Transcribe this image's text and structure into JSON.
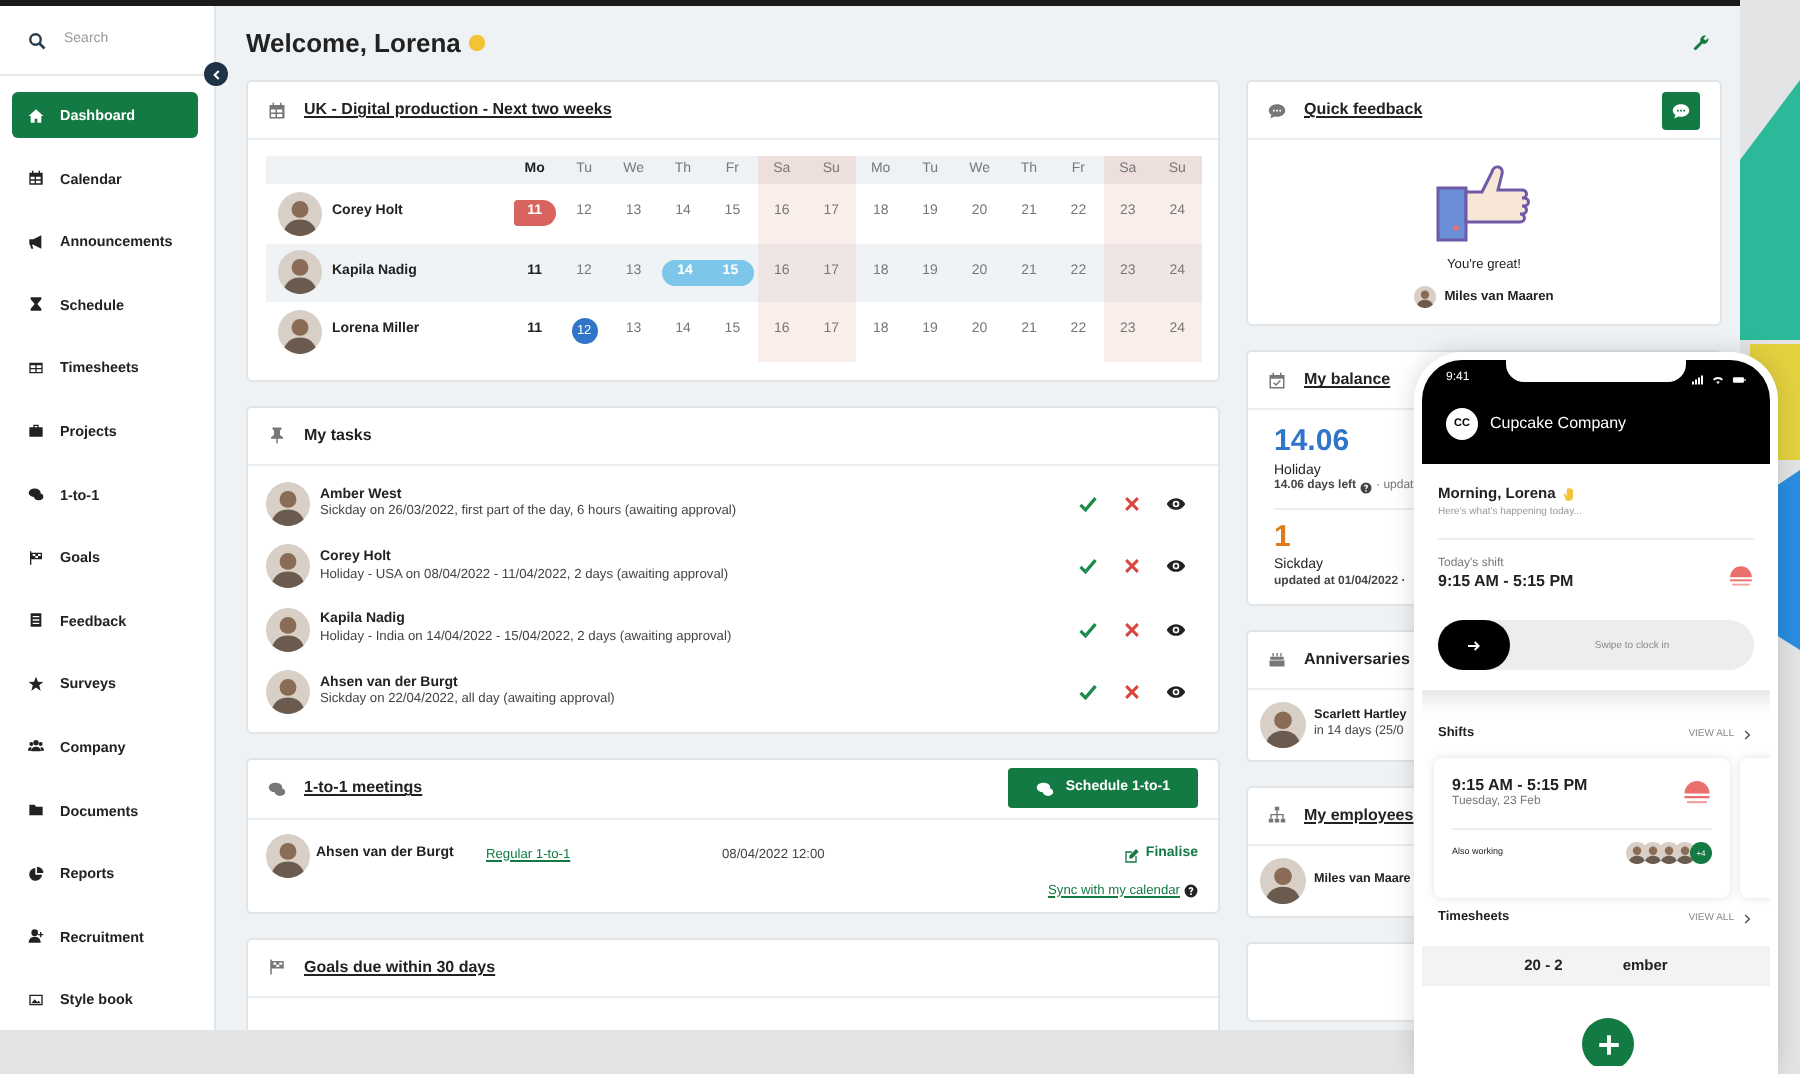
{
  "sidebar": {
    "search_placeholder": "Search",
    "items": [
      {
        "label": "Dashboard",
        "selected": true
      },
      {
        "label": "Calendar",
        "selected": false
      },
      {
        "label": "Announcements",
        "selected": false
      },
      {
        "label": "Schedule",
        "selected": false
      },
      {
        "label": "Timesheets",
        "selected": false
      },
      {
        "label": "Projects",
        "selected": false
      },
      {
        "label": "1-to-1",
        "selected": false
      },
      {
        "label": "Goals",
        "selected": false
      },
      {
        "label": "Feedback",
        "selected": false
      },
      {
        "label": "Surveys",
        "selected": false
      },
      {
        "label": "Company",
        "selected": false
      },
      {
        "label": "Documents",
        "selected": false
      },
      {
        "label": "Reports",
        "selected": false
      },
      {
        "label": "Recruitment",
        "selected": false
      },
      {
        "label": "Style book",
        "selected": false
      }
    ]
  },
  "header": {
    "title": "Welcome, Lorena"
  },
  "calendar": {
    "title": "UK - Digital production - Next two weeks",
    "title_link": true,
    "days": [
      {
        "label": "Mo",
        "bold": true,
        "weekend": false
      },
      {
        "label": "Tu",
        "bold": false,
        "weekend": false
      },
      {
        "label": "We",
        "bold": false,
        "weekend": false
      },
      {
        "label": "Th",
        "bold": false,
        "weekend": false
      },
      {
        "label": "Fr",
        "bold": false,
        "weekend": false
      },
      {
        "label": "Sa",
        "bold": false,
        "weekend": true
      },
      {
        "label": "Su",
        "bold": false,
        "weekend": true
      },
      {
        "label": "Mo",
        "bold": false,
        "weekend": false
      },
      {
        "label": "Tu",
        "bold": false,
        "weekend": false
      },
      {
        "label": "We",
        "bold": false,
        "weekend": false
      },
      {
        "label": "Th",
        "bold": false,
        "weekend": false
      },
      {
        "label": "Fr",
        "bold": false,
        "weekend": false
      },
      {
        "label": "Sa",
        "bold": false,
        "weekend": true
      },
      {
        "label": "Su",
        "bold": false,
        "weekend": true
      }
    ],
    "rows": [
      {
        "name": "Corey Holt",
        "cells": [
          {
            "label": "11",
            "kind": "sick"
          },
          {
            "label": "12",
            "kind": "plain"
          },
          {
            "label": "13",
            "kind": "plain"
          },
          {
            "label": "14",
            "kind": "plain"
          },
          {
            "label": "15",
            "kind": "plain"
          },
          {
            "label": "16",
            "kind": "plain"
          },
          {
            "label": "17",
            "kind": "plain"
          },
          {
            "label": "18",
            "kind": "plain"
          },
          {
            "label": "19",
            "kind": "plain"
          },
          {
            "label": "20",
            "kind": "plain"
          },
          {
            "label": "21",
            "kind": "plain"
          },
          {
            "label": "22",
            "kind": "plain"
          },
          {
            "label": "23",
            "kind": "plain"
          },
          {
            "label": "24",
            "kind": "plain"
          }
        ]
      },
      {
        "name": "Kapila Nadig",
        "cells": [
          {
            "label": "11",
            "kind": "bold"
          },
          {
            "label": "12",
            "kind": "plain"
          },
          {
            "label": "13",
            "kind": "plain"
          },
          {
            "label": "14",
            "kind": "holiday"
          },
          {
            "label": "15",
            "kind": "holiday"
          },
          {
            "label": "16",
            "kind": "plain"
          },
          {
            "label": "17",
            "kind": "plain"
          },
          {
            "label": "18",
            "kind": "plain"
          },
          {
            "label": "19",
            "kind": "plain"
          },
          {
            "label": "20",
            "kind": "plain"
          },
          {
            "label": "21",
            "kind": "plain"
          },
          {
            "label": "22",
            "kind": "plain"
          },
          {
            "label": "23",
            "kind": "plain"
          },
          {
            "label": "24",
            "kind": "plain"
          }
        ]
      },
      {
        "name": "Lorena Miller",
        "cells": [
          {
            "label": "11",
            "kind": "bold"
          },
          {
            "label": "12",
            "kind": "today"
          },
          {
            "label": "13",
            "kind": "plain"
          },
          {
            "label": "14",
            "kind": "plain"
          },
          {
            "label": "15",
            "kind": "plain"
          },
          {
            "label": "16",
            "kind": "plain"
          },
          {
            "label": "17",
            "kind": "plain"
          },
          {
            "label": "18",
            "kind": "plain"
          },
          {
            "label": "19",
            "kind": "plain"
          },
          {
            "label": "20",
            "kind": "plain"
          },
          {
            "label": "21",
            "kind": "plain"
          },
          {
            "label": "22",
            "kind": "plain"
          },
          {
            "label": "23",
            "kind": "plain"
          },
          {
            "label": "24",
            "kind": "plain"
          }
        ]
      }
    ]
  },
  "tasks": {
    "title": "My tasks",
    "title_link": false,
    "items": [
      {
        "name": "Amber West",
        "detail": "Sickday on 26/03/2022, first part of the day, 6 hours (awaiting approval)"
      },
      {
        "name": "Corey Holt",
        "detail": "Holiday - USA on 08/04/2022 - 11/04/2022, 2 days (awaiting approval)"
      },
      {
        "name": "Kapila Nadig",
        "detail": "Holiday - India on 14/04/2022 - 15/04/2022, 2 days (awaiting approval)"
      },
      {
        "name": "Ahsen van der Burgt",
        "detail": "Sickday on 22/04/2022, all day (awaiting approval)"
      }
    ]
  },
  "meetings": {
    "title": "1-to-1 meetings",
    "title_link": true,
    "button": "Schedule 1-to-1",
    "rows": [
      {
        "name": "Ahsen van der Burgt",
        "type": "Regular 1-to-1",
        "date": "08/04/2022 12:00",
        "action": "Finalise"
      }
    ],
    "sync_link": "Sync with my calendar"
  },
  "goals": {
    "title": "Goals due within 30 days",
    "title_link": true
  },
  "feedback": {
    "title": "Quick feedback",
    "title_link": true,
    "message": "You're great!",
    "author": "Miles van Maaren"
  },
  "balance": {
    "title": "My balance",
    "title_link": true,
    "entries": [
      {
        "value": "14.06",
        "label": "Holiday",
        "note": "14.06 days left",
        "note_help": true,
        "note_tail": "· updat",
        "color": "#2f76c9"
      },
      {
        "value": "1",
        "label": "Sickday",
        "note": "updated at 01/04/2022 ·",
        "note_help": false,
        "color": "#e07b1a"
      }
    ]
  },
  "anniversaries": {
    "title": "Anniversaries",
    "title_link": false,
    "people": [
      {
        "name": "Scarlett Hartley",
        "detail": "in 14 days (25/0"
      }
    ]
  },
  "employees": {
    "title": "My employees",
    "title_link": true,
    "people": [
      {
        "name": "Miles van Maare"
      }
    ]
  },
  "phone": {
    "time": "9:41",
    "company_initials": "CC",
    "company": "Cupcake Company",
    "greeting": "Morning, Lorena",
    "subtitle": "Here's what's happening today...",
    "shift_label": "Today's shift",
    "shift_time": "9:15 AM - 5:15 PM",
    "swipe": "Swipe to clock in",
    "shifts": {
      "title": "Shifts",
      "view_all": "VIEW ALL",
      "time": "9:15 AM - 5:15 PM",
      "date": "Tuesday, 23 Feb",
      "also": "Also working",
      "extra": "+4"
    },
    "timesheets": {
      "title": "Timesheets",
      "view_all": "VIEW ALL",
      "range_parts": [
        "20 - 2",
        "ember"
      ]
    }
  }
}
